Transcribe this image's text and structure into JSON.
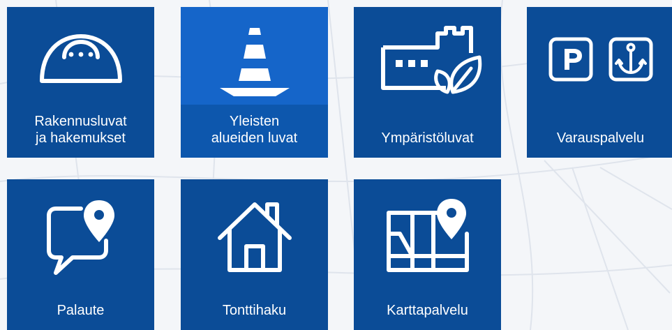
{
  "colors": {
    "tile": "#0b4c97",
    "tile_active": "#1565c9",
    "icon": "#ffffff",
    "background": "#f4f6f9"
  },
  "tiles": [
    {
      "label": "Rakennusluvat\nja hakemukset",
      "icon": "hard-hat-icon"
    },
    {
      "label": "Yleisten\nalueiden luvat",
      "icon": "traffic-cone-icon"
    },
    {
      "label": "Ympäristöluvat",
      "icon": "factory-leaf-icon"
    },
    {
      "label": "Varauspalvelu",
      "icon": "parking-anchor-icon"
    },
    {
      "label": "Palaute",
      "icon": "feedback-pin-icon"
    },
    {
      "label": "Tonttihaku",
      "icon": "house-icon"
    },
    {
      "label": "Karttapalvelu",
      "icon": "map-pin-icon"
    }
  ]
}
